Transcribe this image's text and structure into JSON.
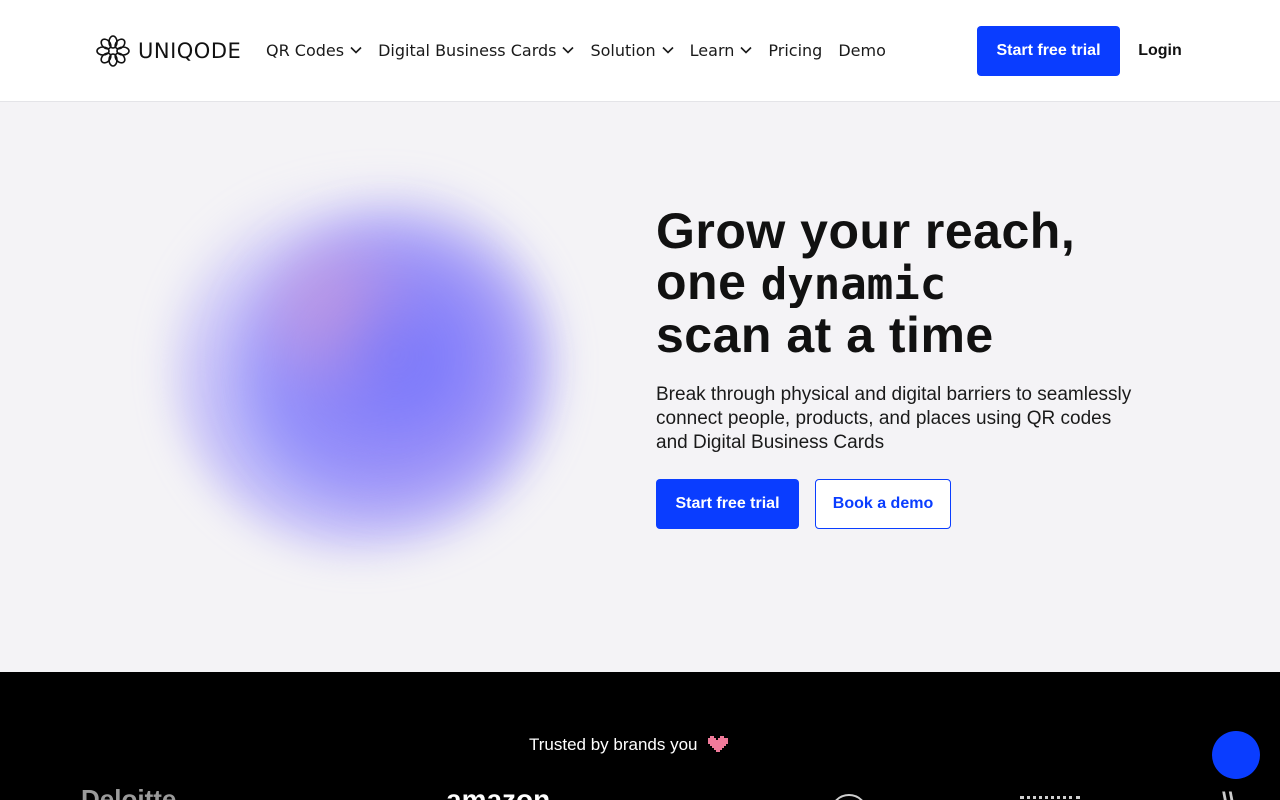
{
  "brand": {
    "name": "UNIQODE",
    "logo_icon": "flower-knot-icon"
  },
  "nav": {
    "items": [
      {
        "label": "QR Codes",
        "has_dropdown": true
      },
      {
        "label": "Digital Business Cards",
        "has_dropdown": true
      },
      {
        "label": "Solution",
        "has_dropdown": true
      },
      {
        "label": "Learn",
        "has_dropdown": true
      },
      {
        "label": "Pricing",
        "has_dropdown": false
      },
      {
        "label": "Demo",
        "has_dropdown": false
      }
    ],
    "cta_label": "Start free trial",
    "login_label": "Login"
  },
  "hero": {
    "title_line1": "Grow your reach,",
    "title_line2_prefix": "one ",
    "title_highlight": "dynamic",
    "title_line3": "scan at a time",
    "subtitle": "Break through physical and digital barriers to seamlessly connect people, products, and places using QR codes and Digital Business Cards",
    "primary_cta": "Start free trial",
    "secondary_cta": "Book a demo"
  },
  "trusted": {
    "text": "Trusted by brands you",
    "emoji_icon": "pixel-heart-icon",
    "brands": [
      "Deloitte",
      "amazon"
    ]
  },
  "colors": {
    "accent": "#0a3dff",
    "hero_bg": "#f4f3f6",
    "footer_bg": "#000000"
  }
}
